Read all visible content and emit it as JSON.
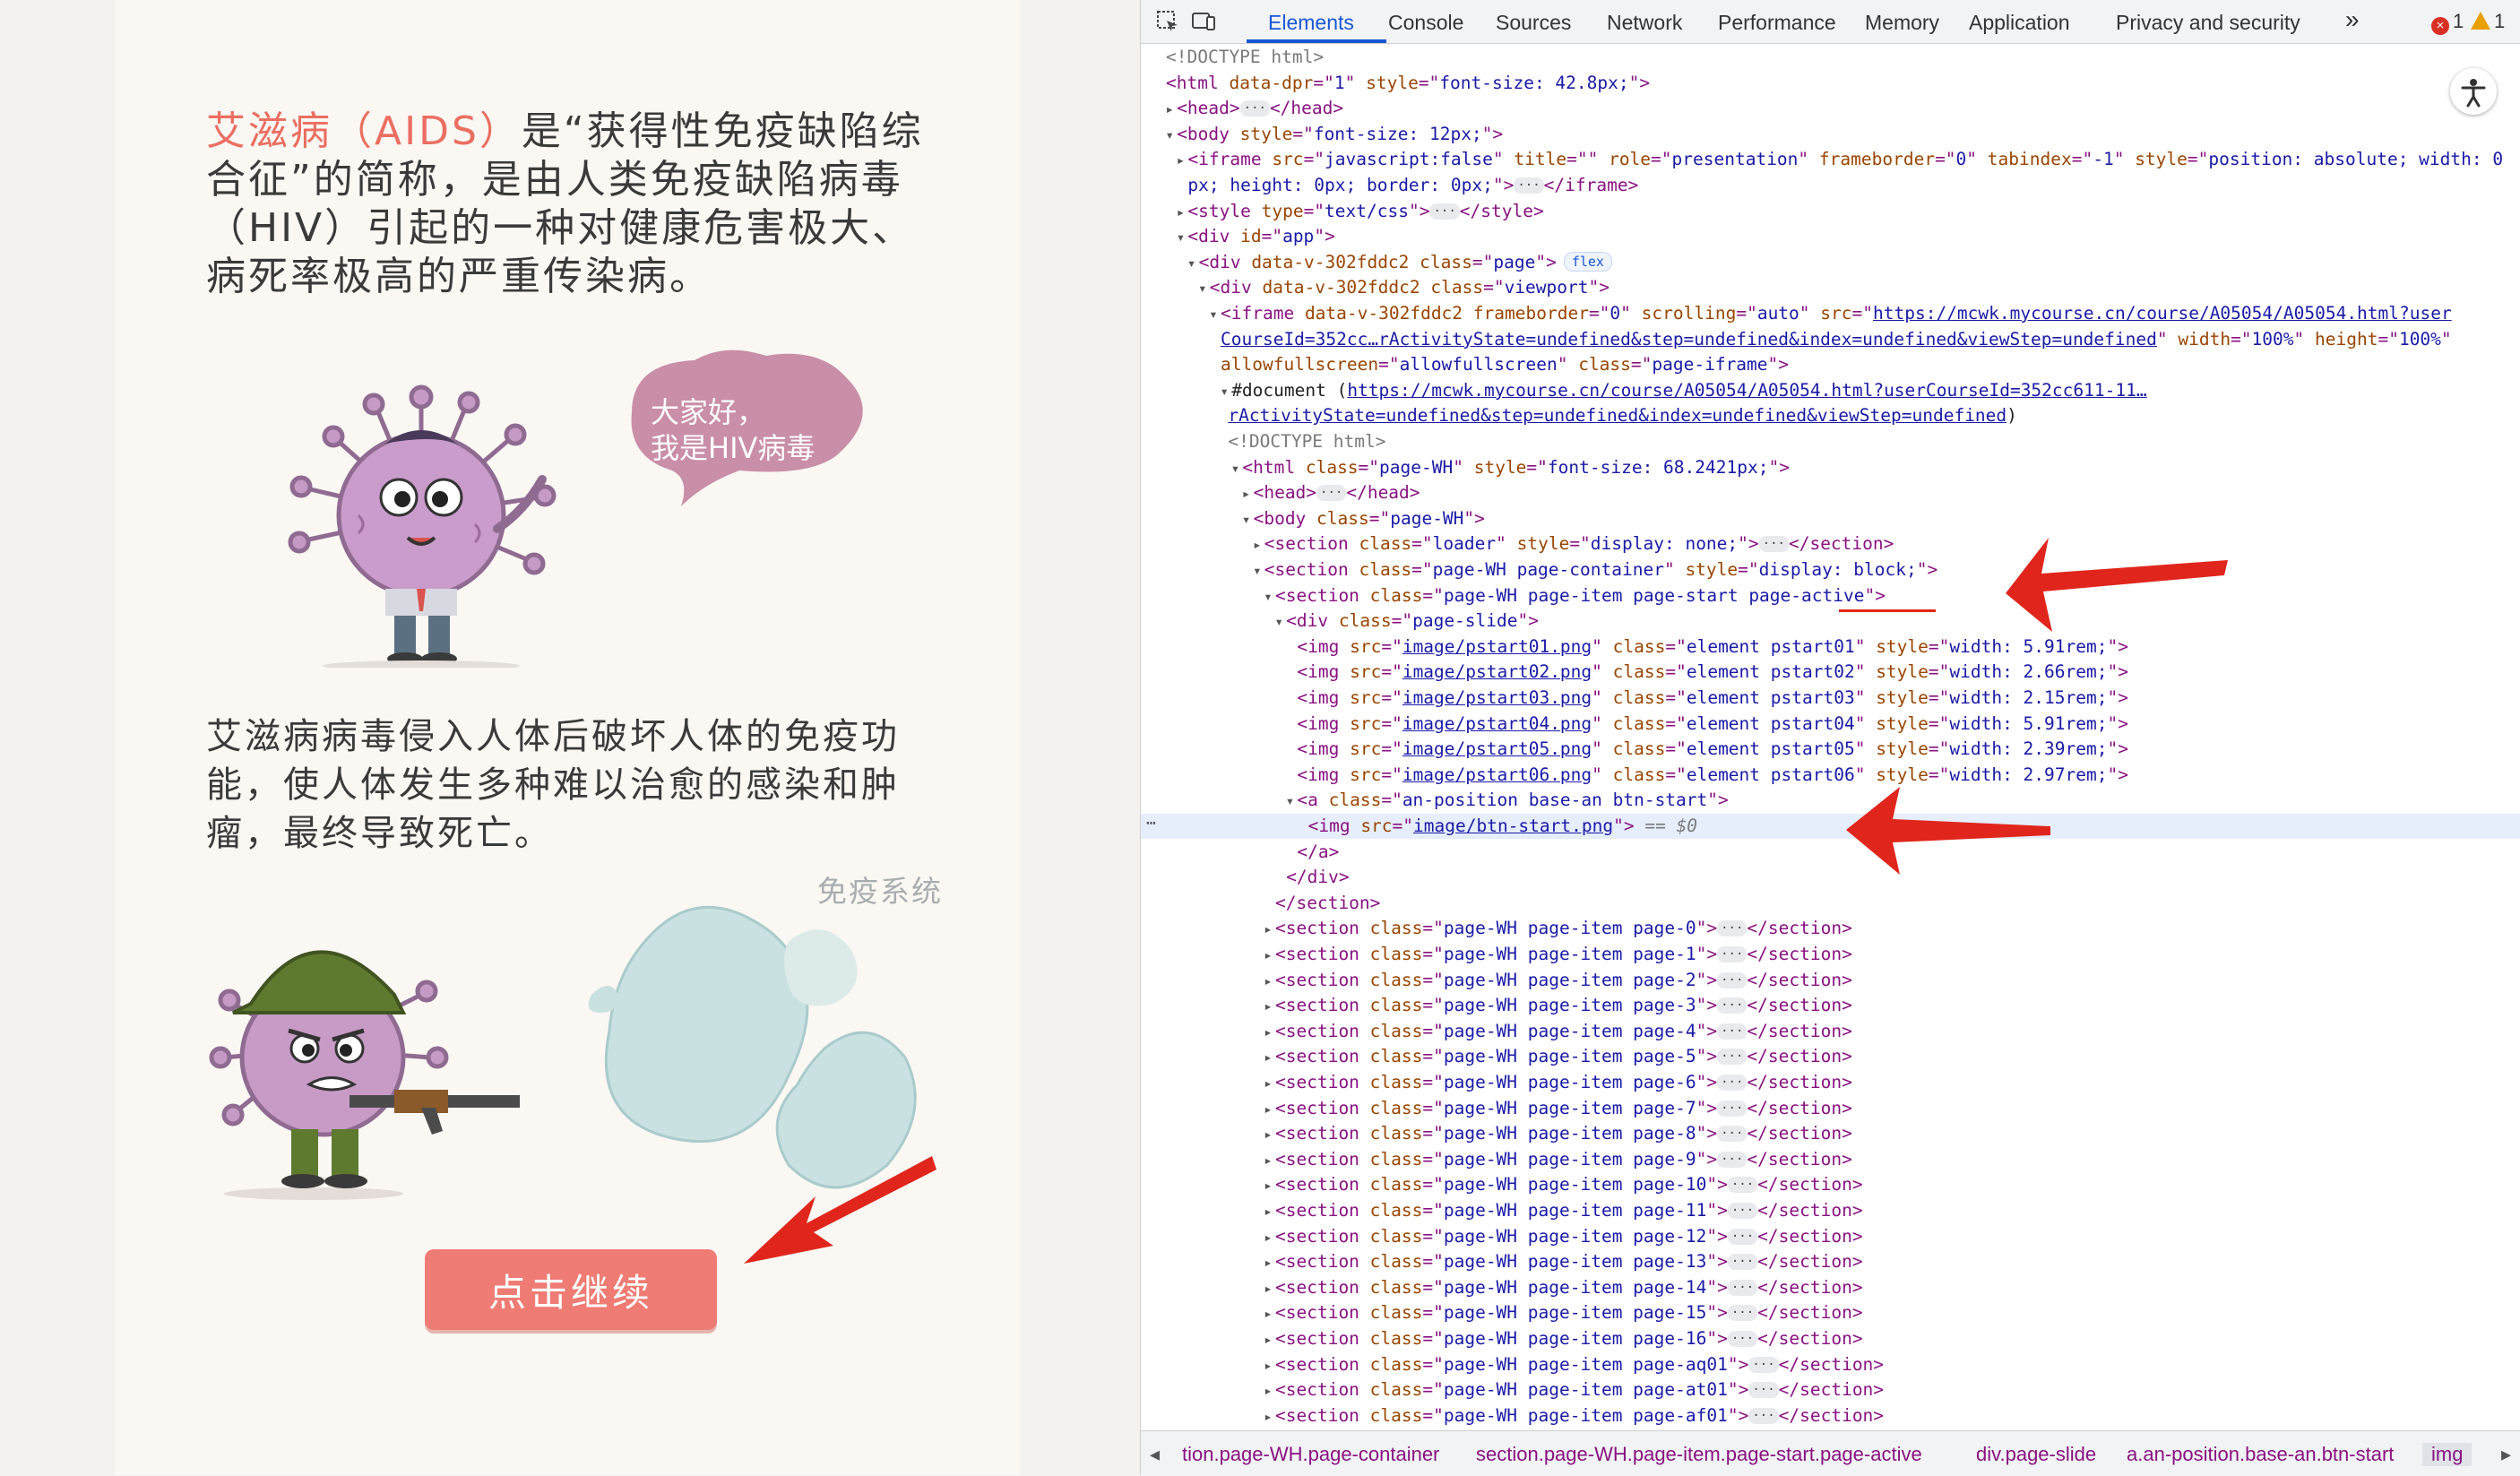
{
  "preview": {
    "intro_highlight": "艾滋病（AIDS）",
    "intro_rest": "是“获得性免疫缺陷综合征”的简称，是由人类免疫缺陷病毒（HIV）引起的一种对健康危害极大、病死率极高的严重传染病。",
    "bubble_line1": "大家好，",
    "bubble_line2": "我是HIV病毒",
    "paragraph2": "艾滋病病毒侵入人体后破坏人体的免疫功能，使人体发生多种难以治愈的感染和肿瘤，最终导致死亡。",
    "immune_label": "免疫系统",
    "continue_button": "点击继续"
  },
  "devtools": {
    "tabs": [
      "Elements",
      "Console",
      "Sources",
      "Network",
      "Performance",
      "Memory",
      "Application",
      "Privacy and security"
    ],
    "more_tabs": "»",
    "errors": "1",
    "warnings": "1",
    "selected_suffix": "== $0",
    "breadcrumbs": [
      "tion.page-WH.page-container",
      "section.page-WH.page-item.page-start.page-active",
      "div.page-slide",
      "a.an-position.base-an.btn-start",
      "img"
    ],
    "doctype": "<!DOCTYPE html>",
    "html_attrs": {
      "dpr_name": "data-dpr",
      "dpr": "1",
      "style": "font-size: 42.8px;"
    },
    "body_style": "font-size: 12px;",
    "iframe1": {
      "src": "javascript:false",
      "title": "",
      "role": "presentation",
      "frameborder": "0",
      "tabindex": "-1",
      "style_part1": "position: absolute; width: 0",
      "style_part2": "px; height: 0px; border: 0px;"
    },
    "style_type": "text/css",
    "app_id": "app",
    "page_class": "page",
    "viewport_class": "viewport",
    "vattr": "data-v-302fddc2",
    "flex_badge": "flex",
    "iframe2": {
      "frameborder": "0",
      "scrolling": "auto",
      "src_part1": "https://mcwk.mycourse.cn/course/A05054/A05054.html?user",
      "src_part2": "CourseId=352cc…rActivityState=undefined&step=undefined&index=undefined&viewStep=undefined",
      "width": "100%",
      "height": "100%",
      "allowfullscreen": "allowfullscreen",
      "class": "page-iframe"
    },
    "document_label": "#document",
    "document_url_part1": "https://mcwk.mycourse.cn/course/A05054/A05054.html?userCourseId=352cc611-11…",
    "document_url_part2": "rActivityState=undefined&step=undefined&index=undefined&viewStep=undefined",
    "inner_html_class": "page-WH",
    "inner_html_style": "font-size: 68.2421px;",
    "body_class": "page-WH",
    "loader": {
      "class": "loader",
      "style": "display: none;"
    },
    "container": {
      "class": "page-WH page-container",
      "style": "display: block;"
    },
    "start_section_class_a": "page-WH page-item page-start",
    "start_section_class_b": "page-active",
    "slide_class": "page-slide",
    "images": [
      {
        "src": "image/pstart01.png",
        "class": "element pstart01",
        "style": "width: 5.91rem;"
      },
      {
        "src": "image/pstart02.png",
        "class": "element pstart02",
        "style": "width: 2.66rem;"
      },
      {
        "src": "image/pstart03.png",
        "class": "element pstart03",
        "style": "width: 2.15rem;"
      },
      {
        "src": "image/pstart04.png",
        "class": "element pstart04",
        "style": "width: 5.91rem;"
      },
      {
        "src": "image/pstart05.png",
        "class": "element pstart05",
        "style": "width: 2.39rem;"
      },
      {
        "src": "image/pstart06.png",
        "class": "element pstart06",
        "style": "width: 2.97rem;"
      }
    ],
    "anchor_class": "an-position base-an btn-start",
    "btn_img_src": "image/btn-start.png",
    "section_classes": [
      "page-WH page-item page-0",
      "page-WH page-item page-1",
      "page-WH page-item page-2",
      "page-WH page-item page-3",
      "page-WH page-item page-4",
      "page-WH page-item page-5",
      "page-WH page-item page-6",
      "page-WH page-item page-7",
      "page-WH page-item page-8",
      "page-WH page-item page-9",
      "page-WH page-item page-10",
      "page-WH page-item page-11",
      "page-WH page-item page-12",
      "page-WH page-item page-13",
      "page-WH page-item page-14",
      "page-WH page-item page-15",
      "page-WH page-item page-16",
      "page-WH page-item page-aq01",
      "page-WH page-item page-at01",
      "page-WH page-item page-af01"
    ]
  },
  "colors": {
    "highlight": "#e96f62",
    "button": "#ee7c74",
    "arrow": "#e0261c",
    "tab_active": "#1a57d3",
    "tag": "#881280",
    "attr_name": "#994500",
    "attr_value": "#1a1aa6"
  }
}
